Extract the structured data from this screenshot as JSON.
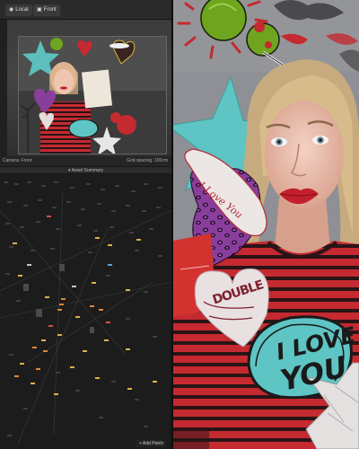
{
  "toolbar": {
    "local_label": "Local",
    "front_label": "Front"
  },
  "viewport_status": {
    "camera": "Camera: Front",
    "grid": "Grid spacing: 100cm"
  },
  "asset_summary": {
    "label": "Asset Summary"
  },
  "patch_editor": {
    "add_patch_label": "+ Add Patch"
  },
  "stickers": {
    "love_bubble": "I Love You",
    "iloveyou_line1": "I LOVE",
    "iloveyou_line2": "YOU",
    "doodle": "DOUBLE"
  },
  "colors": {
    "stripe_red": "#c42a30",
    "stripe_dark": "#2a1416",
    "sticker_cyan": "#5ec4c4",
    "leopard_purple": "#8a3e9c",
    "olive_green": "#6fa41f"
  }
}
